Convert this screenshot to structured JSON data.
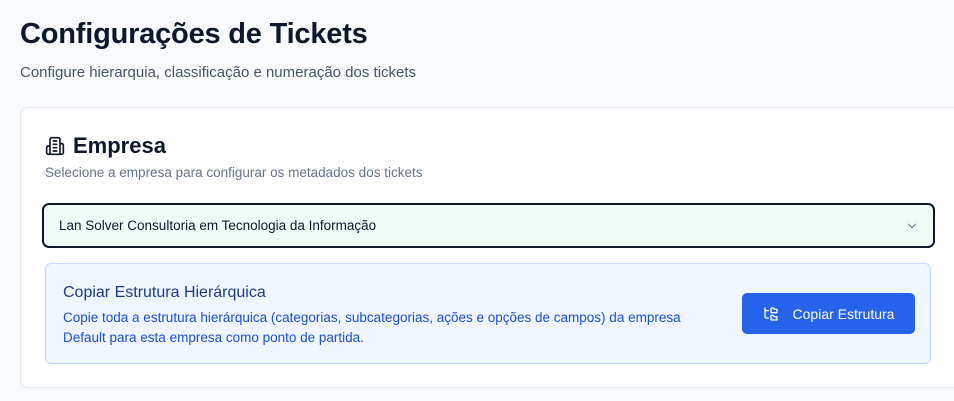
{
  "header": {
    "title": "Configurações de Tickets",
    "subtitle": "Configure hierarquia, classificação e numeração dos tickets"
  },
  "company_card": {
    "icon": "building-icon",
    "title": "Empresa",
    "description": "Selecione a empresa para configurar os metadados dos tickets",
    "select": {
      "selected_value": "Lan Solver Consultoria em Tecnologia da Informação",
      "icon": "chevron-down-icon"
    },
    "copy_structure": {
      "title": "Copiar Estrutura Hierárquica",
      "description": "Copie toda a estrutura hierárquica (categorias, subcategorias, ações e opções de campos) da empresa Default para esta empresa como ponto de partida.",
      "button_label": "Copiar Estrutura",
      "button_icon": "folder-tree-icon"
    }
  },
  "colors": {
    "primary": "#2563eb",
    "info_background": "#eff6ff",
    "info_border": "#bfdbfe",
    "info_title": "#1e3a8a",
    "info_text": "#1d4ed8",
    "select_background": "#f0fbf8"
  }
}
